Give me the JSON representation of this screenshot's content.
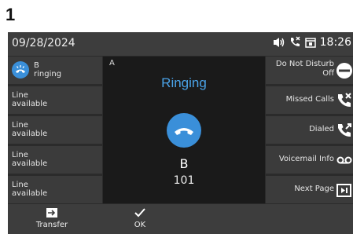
{
  "step": "1",
  "status": {
    "date": "09/28/2024",
    "time": "18:26"
  },
  "lines": [
    {
      "label": "B",
      "status": "ringing"
    },
    {
      "label": "Line",
      "status": "available"
    },
    {
      "label": "Line",
      "status": "available"
    },
    {
      "label": "Line",
      "status": "available"
    },
    {
      "label": "Line",
      "status": "available"
    }
  ],
  "call": {
    "tag": "A",
    "state": "Ringing",
    "name": "B",
    "number": "101"
  },
  "softkeys": [
    {
      "label1": "Do Not Disturb",
      "label2": "Off",
      "icon": "minus-circle-icon"
    },
    {
      "label1": "Missed Calls",
      "label2": "",
      "icon": "missed-call-icon"
    },
    {
      "label1": "Dialed",
      "label2": "",
      "icon": "dialed-call-icon"
    },
    {
      "label1": "Voicemail Info",
      "label2": "",
      "icon": "voicemail-icon"
    },
    {
      "label1": "Next Page",
      "label2": "",
      "icon": "next-page-icon"
    }
  ],
  "bottom": {
    "transfer": "Transfer",
    "ok": "OK"
  },
  "colors": {
    "accent": "#3a8fd9",
    "ringing_text": "#4aa3e8"
  }
}
